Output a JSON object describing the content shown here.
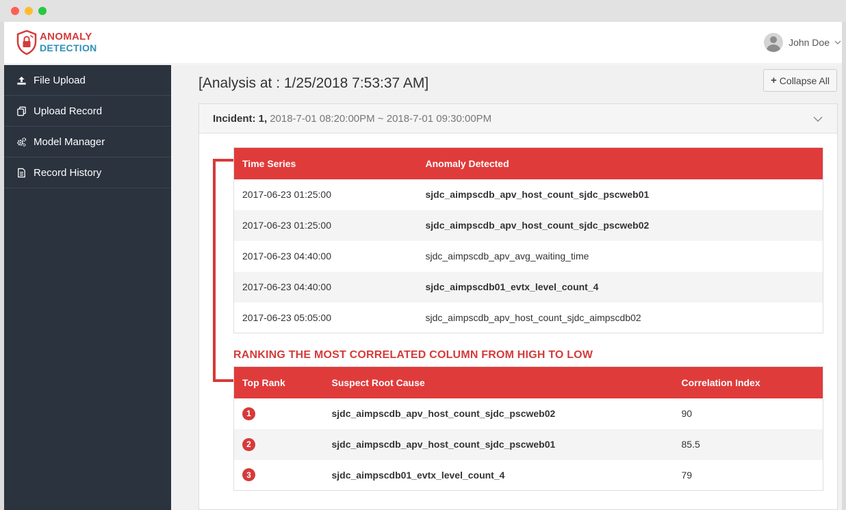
{
  "logo": {
    "line1": "ANOMALY",
    "line2": "DETECTION"
  },
  "user": {
    "name": "John Doe"
  },
  "sidebar": {
    "items": [
      {
        "label": "File Upload",
        "icon": "upload-icon"
      },
      {
        "label": "Upload Record",
        "icon": "copy-icon"
      },
      {
        "label": "Model Manager",
        "icon": "cogs-icon"
      },
      {
        "label": "Record History",
        "icon": "document-icon"
      }
    ]
  },
  "main": {
    "title": "[Analysis at : 1/25/2018 7:53:37 AM]",
    "collapse_label": "Collapse All",
    "incident": {
      "label": "Incident: 1,",
      "range": "2018-7-01 08:20:00PM ~ 2018-7-01 09:30:00PM"
    },
    "anomaly_table": {
      "headers": [
        "Time Series",
        "Anomaly Detected"
      ],
      "rows": [
        {
          "time": "2017-06-23 01:25:00",
          "anomaly": "sjdc_aimpscdb_apv_host_count_sjdc_pscweb01",
          "bold": true
        },
        {
          "time": "2017-06-23 01:25:00",
          "anomaly": "sjdc_aimpscdb_apv_host_count_sjdc_pscweb02",
          "bold": true
        },
        {
          "time": "2017-06-23 04:40:00",
          "anomaly": "sjdc_aimpscdb_apv_avg_waiting_time",
          "bold": false
        },
        {
          "time": "2017-06-23 04:40:00",
          "anomaly": "sjdc_aimpscdb01_evtx_level_count_4",
          "bold": true
        },
        {
          "time": "2017-06-23 05:05:00",
          "anomaly": "sjdc_aimpscdb_apv_host_count_sjdc_aimpscdb02",
          "bold": false
        }
      ]
    },
    "ranking_title": "RANKING THE MOST CORRELATED COLUMN FROM HIGH TO LOW",
    "ranking_table": {
      "headers": [
        "Top Rank",
        "Suspect Root Cause",
        "Correlation Index"
      ],
      "rows": [
        {
          "rank": "1",
          "cause": "sjdc_aimpscdb_apv_host_count_sjdc_pscweb02",
          "index": "90"
        },
        {
          "rank": "2",
          "cause": "sjdc_aimpscdb_apv_host_count_sjdc_pscweb01",
          "index": "85.5"
        },
        {
          "rank": "3",
          "cause": "sjdc_aimpscdb01_evtx_level_count_4",
          "index": "79"
        }
      ]
    }
  },
  "colors": {
    "accent_red": "#e03b3b",
    "brand_blue": "#2f8fb8",
    "sidebar_bg": "#2b333e"
  }
}
